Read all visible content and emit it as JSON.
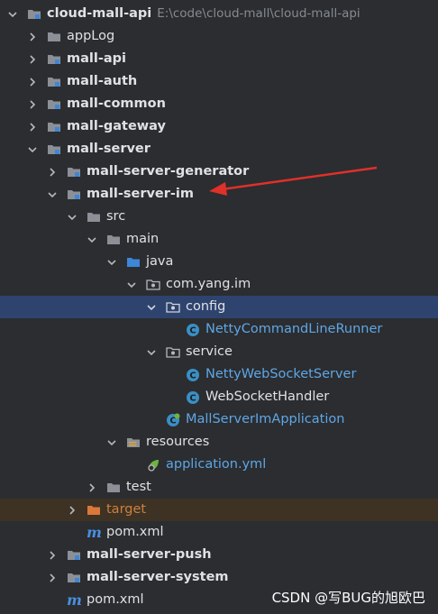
{
  "project_tree": {
    "root": {
      "name": "cloud-mall-api",
      "path": "E:\\code\\cloud-mall\\cloud-mall-api"
    },
    "items": [
      {
        "label": "appLog"
      },
      {
        "label": "mall-api"
      },
      {
        "label": "mall-auth"
      },
      {
        "label": "mall-common"
      },
      {
        "label": "mall-gateway"
      },
      {
        "label": "mall-server"
      },
      {
        "label": "mall-server-generator"
      },
      {
        "label": "mall-server-im"
      },
      {
        "label": "src"
      },
      {
        "label": "main"
      },
      {
        "label": "java"
      },
      {
        "label": "com.yang.im"
      },
      {
        "label": "config"
      },
      {
        "label": "NettyCommandLineRunner"
      },
      {
        "label": "service"
      },
      {
        "label": "NettyWebSocketServer"
      },
      {
        "label": "WebSocketHandler"
      },
      {
        "label": "MallServerImApplication"
      },
      {
        "label": "resources"
      },
      {
        "label": "application.yml"
      },
      {
        "label": "test"
      },
      {
        "label": "target"
      },
      {
        "label": "pom.xml"
      },
      {
        "label": "mall-server-push"
      },
      {
        "label": "mall-server-system"
      },
      {
        "label": "pom.xml"
      }
    ]
  },
  "watermark": "CSDN @写BUG的旭欧巴",
  "colors": {
    "background": "#2b2d30",
    "selection": "#2e436e",
    "excluded_highlight": "#3d3223",
    "class_link": "#5fa6e6",
    "excluded_text": "#cc8040",
    "annotation_arrow": "#e0302a"
  }
}
